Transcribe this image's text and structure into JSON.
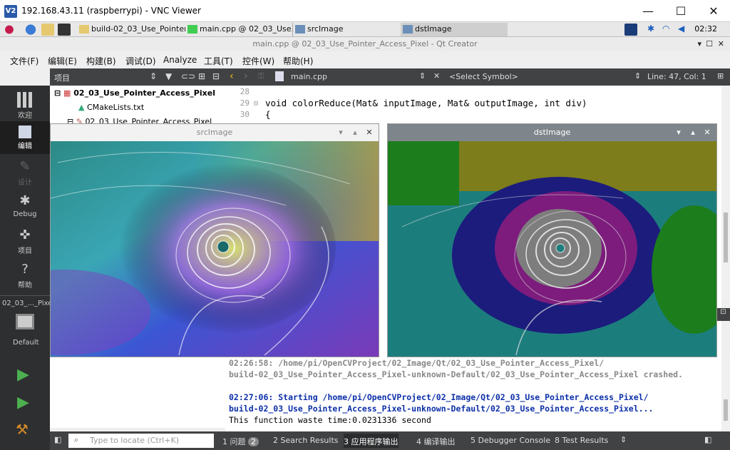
{
  "window": {
    "title": "192.168.43.11 (raspberrypi) - VNC Viewer",
    "logo": "V2",
    "min": "—",
    "max": "☐",
    "close": "✕"
  },
  "taskbar": {
    "tasks": [
      "build-02_03_Use_Pointer...",
      "main.cpp @ 02_03_Use...",
      "srcImage",
      "dstImage"
    ],
    "clock": "02:32"
  },
  "qt": {
    "title": "main.cpp @ 02_03_Use_Pointer_Access_Pixel - Qt Creator"
  },
  "menubar": [
    "文件(F)",
    "编辑(E)",
    "构建(B)",
    "调试(D)",
    "Analyze",
    "工具(T)",
    "控件(W)",
    "帮助(H)"
  ],
  "navbar": {
    "label": "项目"
  },
  "editor": {
    "file": "main.cpp",
    "symbol": "<Select Symbol>",
    "position": "Line: 47, Col: 1"
  },
  "modes": [
    "欢迎",
    "编辑",
    "设计",
    "Debug",
    "项目",
    "帮助"
  ],
  "kit": {
    "project": "02_03_..._Pixel",
    "build": "Default"
  },
  "tree": [
    "02_03_Use_Pointer_Access_Pixel",
    "CMakeLists.txt",
    "02_03_Use_Pointer_Access_Pixel"
  ],
  "code": {
    "line28": "28",
    "line29": "29",
    "line30": "30",
    "fn": "void colorReduce(Mat& inputImage, Mat& outputImage, int div)",
    "brace": "{"
  },
  "output": [
    "02:26:58: /home/pi/OpenCVProject/02_Image/Qt/02_03_Use_Pointer_Access_Pixel/",
    "build-02_03_Use_Pointer_Access_Pixel-unknown-Default/02_03_Use_Pointer_Access_Pixel crashed.",
    "02:27:06: Starting /home/pi/OpenCVProject/02_Image/Qt/02_03_Use_Pointer_Access_Pixel/",
    "build-02_03_Use_Pointer_Access_Pixel-unknown-Default/02_03_Use_Pointer_Access_Pixel...",
    "This function  waste time:0.0231336 second"
  ],
  "bottom": {
    "locate": "Type to locate (Ctrl+K)",
    "tabs": [
      "1  问题",
      "2  Search Results",
      "3  应用程序输出",
      "4  编译输出",
      "5  Debugger Console",
      "8  Test Results"
    ],
    "issues_count": "2"
  },
  "images": {
    "src": "srcImage",
    "dst": "dstImage"
  }
}
